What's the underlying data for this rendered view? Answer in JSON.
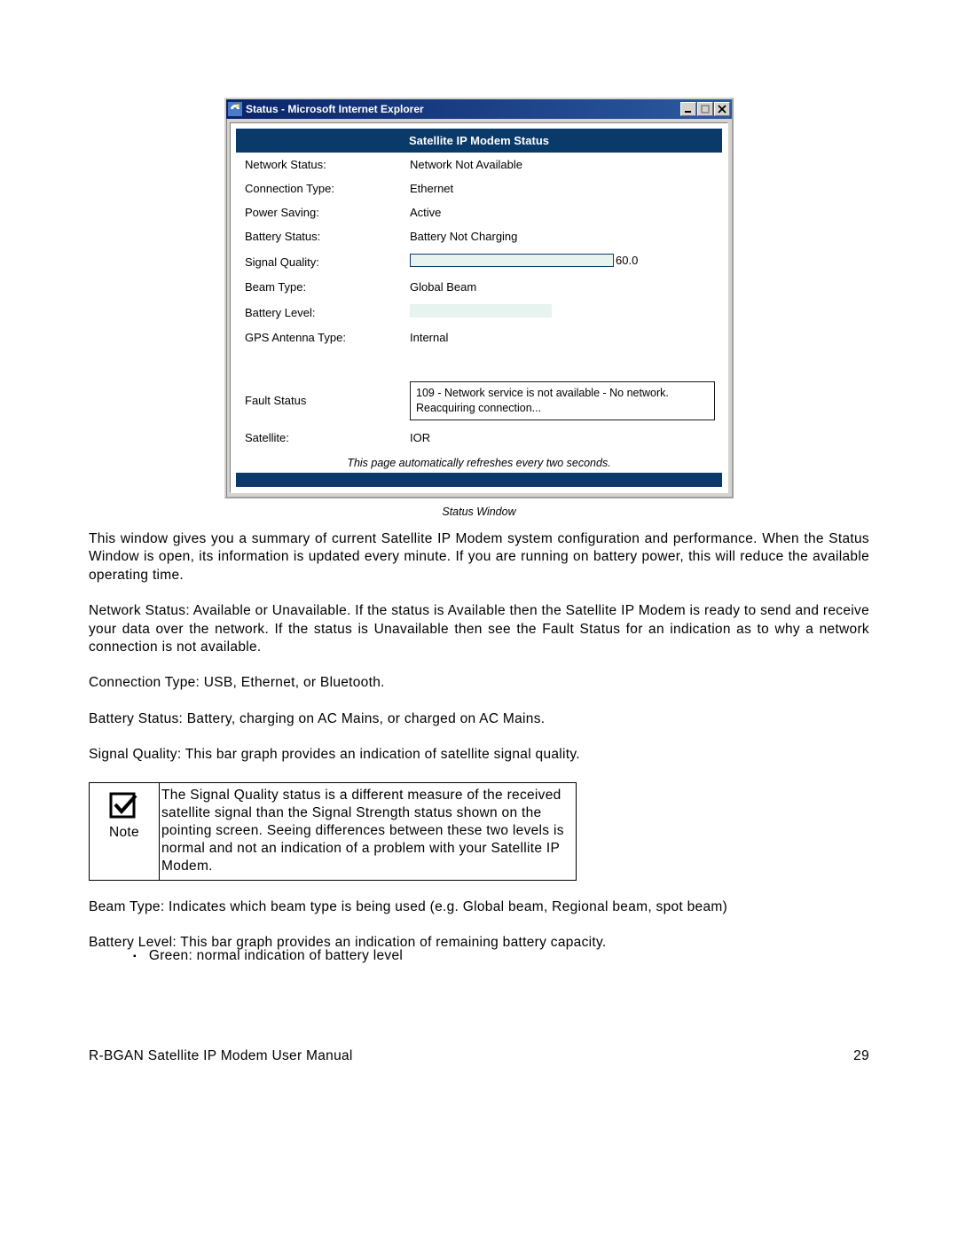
{
  "window": {
    "title": "Status - Microsoft Internet Explorer"
  },
  "panel": {
    "heading": "Satellite IP Modem Status",
    "refresh_note": "This page automatically refreshes every two seconds."
  },
  "rows": {
    "network_status": {
      "label": "Network Status:",
      "value": "Network Not Available"
    },
    "connection_type": {
      "label": "Connection Type:",
      "value": "Ethernet"
    },
    "power_saving": {
      "label": "Power Saving:",
      "value": "Active"
    },
    "battery_status": {
      "label": "Battery Status:",
      "value": "Battery Not Charging"
    },
    "signal_quality": {
      "label": "Signal Quality:",
      "percent": 60,
      "value_text": "60.0"
    },
    "beam_type": {
      "label": "Beam Type:",
      "value": "Global Beam"
    },
    "battery_level": {
      "label": "Battery Level:",
      "percent": 100
    },
    "gps_antenna": {
      "label": "GPS Antenna Type:",
      "value": "Internal"
    },
    "fault_status": {
      "label": "Fault Status",
      "value": "109 - Network service is not available - No network. Reacquiring connection..."
    },
    "satellite": {
      "label": "Satellite:",
      "value": "IOR"
    }
  },
  "caption": "Status Window",
  "paragraphs": {
    "p1": "This window gives you a summary of current Satellite IP Modem system configuration and performance. When the Status Window is open, its information is updated every minute. If you are running on battery power, this will reduce the available operating time.",
    "p2": "Network Status: Available or Unavailable. If the status is Available then the Satellite IP Modem is ready to send and receive your data over the network. If the status is Unavailable then see the Fault Status for an indication as to why a network connection is not available.",
    "p3": "Connection Type: USB, Ethernet, or Bluetooth.",
    "p4": "Battery Status: Battery, charging on AC Mains, or charged on AC Mains.",
    "p5": "Signal Quality: This bar graph provides an indication of satellite signal quality.",
    "p6": "Beam Type: Indicates which beam type is being used (e.g. Global beam, Regional beam, spot beam)",
    "p7": "Battery Level: This bar graph provides an indication of remaining battery capacity."
  },
  "note": {
    "label": "Note",
    "text": "The Signal Quality status is a different measure of the received satellite signal than the Signal Strength status shown on the pointing screen. Seeing differences between these two levels is normal and not an indication of a problem with your Satellite IP Modem."
  },
  "bullets": {
    "b1": "Green:  normal indication of battery level"
  },
  "footer": {
    "left": "R-BGAN Satellite IP Modem User Manual",
    "right": "29"
  }
}
